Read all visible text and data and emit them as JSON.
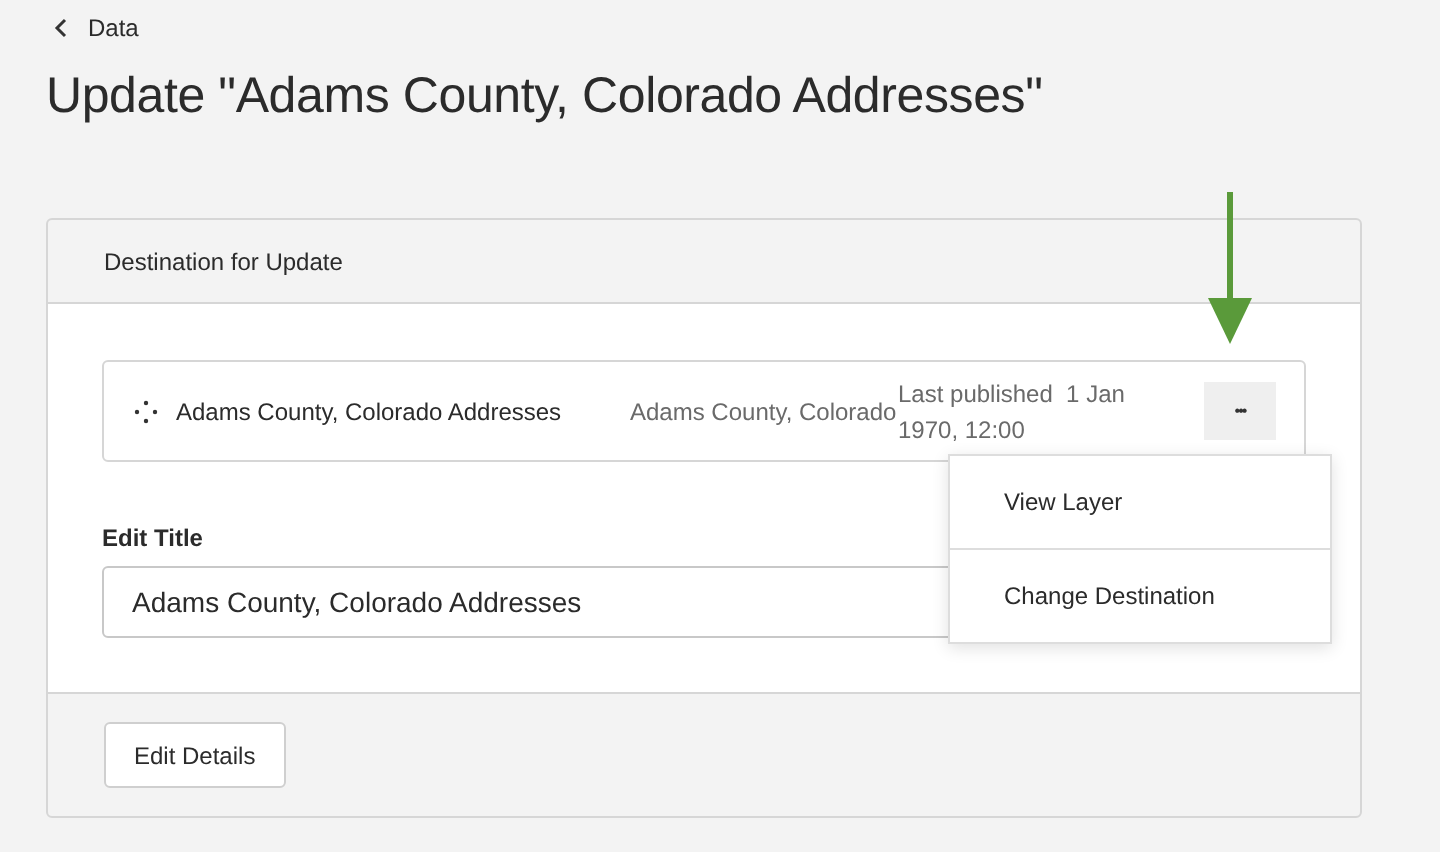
{
  "breadcrumb": {
    "label": "Data"
  },
  "title": "Update \"Adams County, Colorado Addresses\"",
  "card": {
    "header": "Destination for Update",
    "layer": {
      "name": "Adams County, Colorado Addresses",
      "description": "Adams County, Colorado",
      "published_label": "Last published",
      "published_date": "1 Jan 1970, 12:00",
      "more_label": "•••"
    },
    "menu": {
      "items": [
        "View Layer",
        "Change Destination"
      ]
    },
    "edit_title": {
      "label": "Edit Title",
      "value": "Adams County, Colorado Addresses"
    },
    "footer_button": "Edit Details"
  }
}
